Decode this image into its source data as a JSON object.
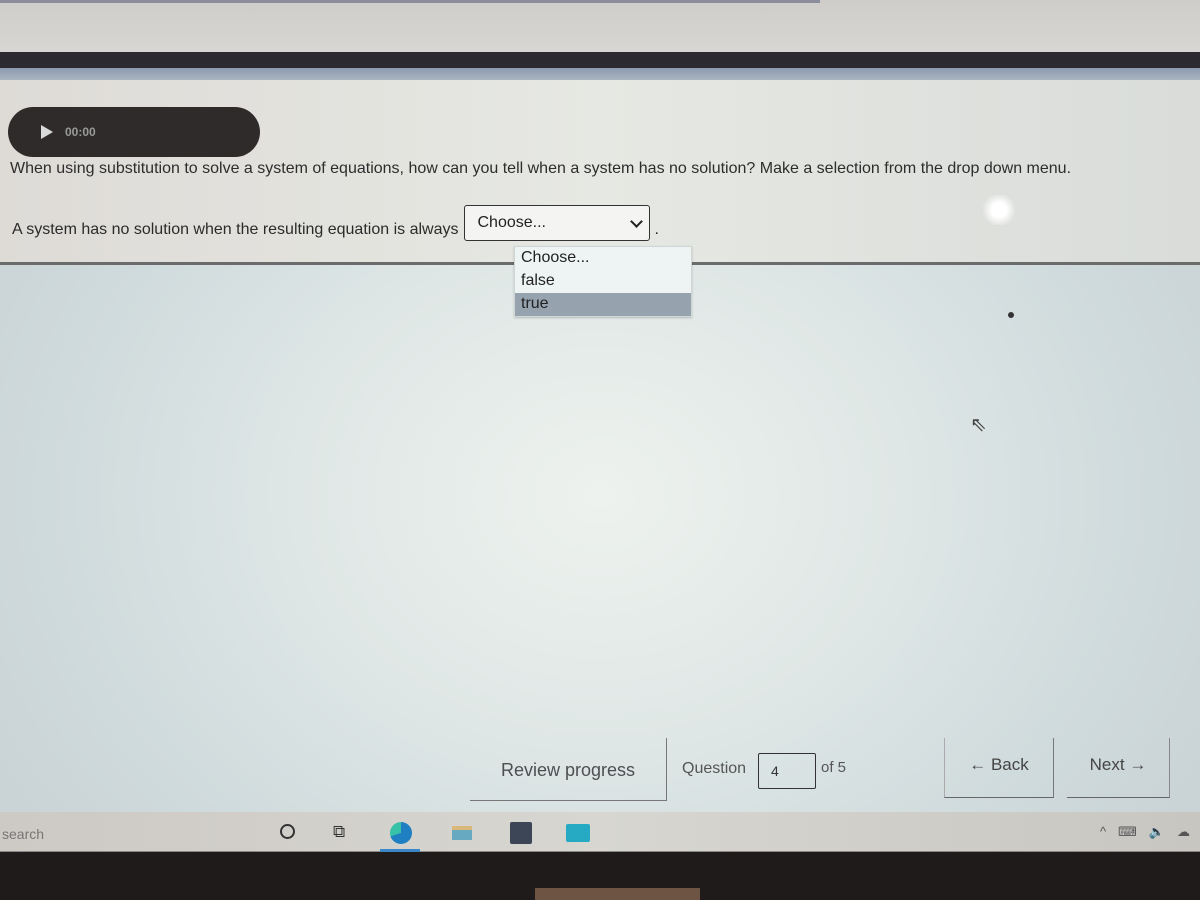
{
  "audio": {
    "play_icon": "play-icon",
    "time": "00:00"
  },
  "question": {
    "text": "When using substitution to solve a system of equations, how can you tell when a system has no solution? Make a selection from the drop down menu.",
    "answer_prefix": "A system has no solution when the resulting equation is always",
    "answer_suffix": ".",
    "select": {
      "value": "Choose...",
      "options": [
        "Choose...",
        "false",
        "true"
      ],
      "highlighted": "true"
    }
  },
  "navigation": {
    "review_label": "Review progress",
    "question_label": "Question",
    "question_number": "4",
    "of_label": "of 5",
    "back_label": "← Back",
    "next_label": "Next →"
  },
  "taskbar": {
    "search_label": "search",
    "icons": [
      "cortana-icon",
      "task-view-icon",
      "edge-icon",
      "file-explorer-icon",
      "store-icon",
      "mail-icon"
    ],
    "tray": [
      "^",
      "⌨",
      "🔈",
      "☁"
    ]
  },
  "colors": {
    "dropdown_highlight": "#96a2ae",
    "player_bg": "#2f2b2b",
    "edge_underline": "#3a86c8"
  }
}
